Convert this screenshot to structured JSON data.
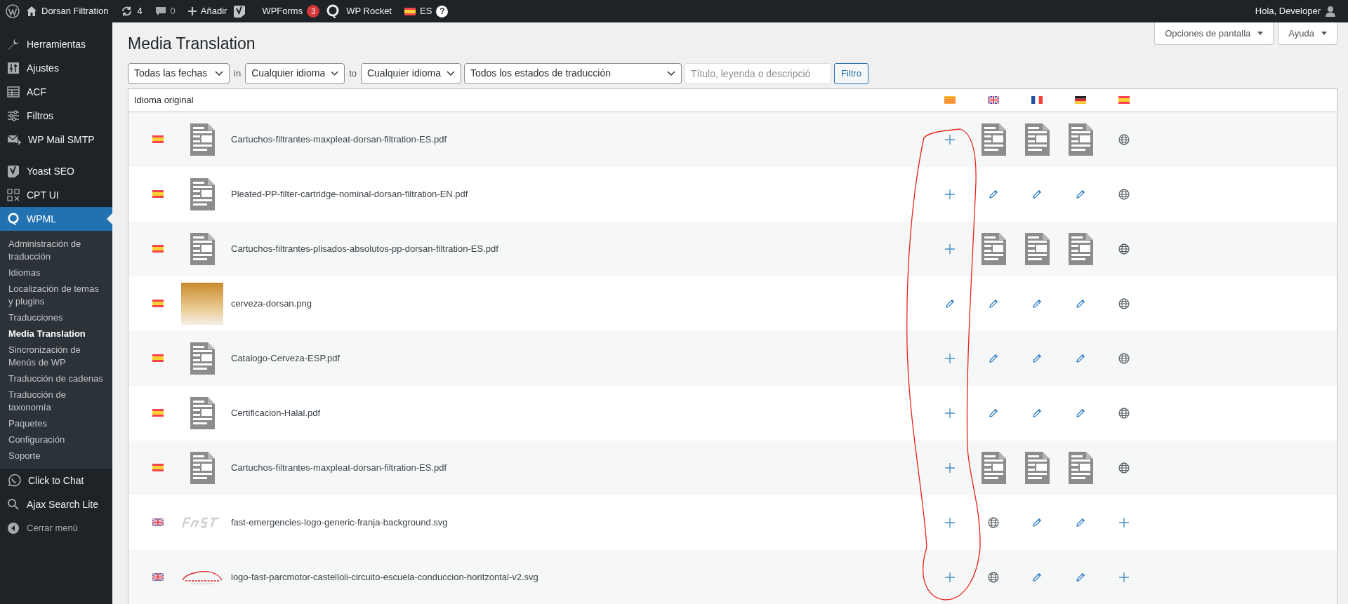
{
  "admin_bar": {
    "site": "Dorsan Filtration",
    "updates": "4",
    "comments": "0",
    "new": "Añadir",
    "wpforms": "WPForms",
    "wpforms_count": "3",
    "rocket": "WP Rocket",
    "language_flag": {
      "kind": "es"
    },
    "language": "ES",
    "help": "?",
    "greeting": "Hola, Developer"
  },
  "sidebar": {
    "groups": [
      {
        "items": [
          {
            "label": "Herramientas",
            "selected": false
          },
          {
            "label": "Ajustes",
            "selected": false
          },
          {
            "label": "ACF",
            "selected": false
          },
          {
            "label": "Filtros",
            "selected": false
          },
          {
            "label": "WP Mail SMTP",
            "selected": false
          }
        ]
      },
      {
        "items": [
          {
            "label": "Yoast SEO",
            "selected": false
          },
          {
            "label": "CPT UI",
            "selected": false
          },
          {
            "label": "WPML",
            "selected": true,
            "children": [
              {
                "label": "Administración de traducción",
                "selected": false
              },
              {
                "label": "Idiomas",
                "selected": false
              },
              {
                "label": "Localización de temas y plugins",
                "selected": false
              },
              {
                "label": "Traducciones",
                "selected": false
              },
              {
                "label": "Media Translation",
                "selected": true
              },
              {
                "label": "Sincronización de Menús de WP",
                "selected": false
              },
              {
                "label": "Traducción de cadenas",
                "selected": false
              },
              {
                "label": "Traducción de taxonomía",
                "selected": false
              },
              {
                "label": "Paquetes",
                "selected": false
              },
              {
                "label": "Configuración",
                "selected": false
              },
              {
                "label": "Soporte",
                "selected": false
              }
            ]
          },
          {
            "label": "Click to Chat",
            "selected": false
          },
          {
            "label": "Ajax Search Lite",
            "selected": false
          }
        ]
      }
    ],
    "collapse": "Cerrar menú"
  },
  "header": {
    "title": "Media Translation",
    "screen_options": "Opciones de pantalla",
    "help": "Ayuda"
  },
  "filters": {
    "date": "Todas las fechas",
    "in": "in",
    "from_language": "Cualquier idioma",
    "to": "to",
    "to_language": "Cualquier idioma",
    "status": "Todos los estados de traducción",
    "search_placeholder": "Título, leyenda o descripció",
    "button": "Filtro"
  },
  "table": {
    "column_header": "Idioma original",
    "language_columns": [
      {
        "kind": "ca"
      },
      {
        "kind": "en"
      },
      {
        "kind": "fr"
      },
      {
        "kind": "de"
      },
      {
        "kind": "es"
      }
    ],
    "rows": [
      {
        "flag": {
          "kind": "es"
        },
        "thumb": {
          "kind": "document"
        },
        "file": "Cartuchos-filtrantes-maxpleat-dorsan-filtration-ES.pdf",
        "cells": [
          {
            "kind": "add"
          },
          {
            "kind": "doc"
          },
          {
            "kind": "doc"
          },
          {
            "kind": "doc"
          },
          {
            "kind": "original"
          }
        ]
      },
      {
        "flag": {
          "kind": "es"
        },
        "thumb": {
          "kind": "document"
        },
        "file": "Pleated-PP-filter-cartridge-nominal-dorsan-filtration-EN.pdf",
        "cells": [
          {
            "kind": "add"
          },
          {
            "kind": "edit"
          },
          {
            "kind": "edit"
          },
          {
            "kind": "edit"
          },
          {
            "kind": "original"
          }
        ]
      },
      {
        "flag": {
          "kind": "es"
        },
        "thumb": {
          "kind": "document"
        },
        "file": "Cartuchos-filtrantes-plisados-absolutos-pp-dorsan-filtration-ES.pdf",
        "cells": [
          {
            "kind": "add"
          },
          {
            "kind": "doc"
          },
          {
            "kind": "doc"
          },
          {
            "kind": "doc"
          },
          {
            "kind": "original"
          }
        ]
      },
      {
        "flag": {
          "kind": "es"
        },
        "thumb": {
          "kind": "photo"
        },
        "file": "cerveza-dorsan.png",
        "cells": [
          {
            "kind": "edit"
          },
          {
            "kind": "edit"
          },
          {
            "kind": "edit"
          },
          {
            "kind": "edit"
          },
          {
            "kind": "original"
          }
        ]
      },
      {
        "flag": {
          "kind": "es"
        },
        "thumb": {
          "kind": "document"
        },
        "file": "Catalogo-Cerveza-ESP.pdf",
        "cells": [
          {
            "kind": "add"
          },
          {
            "kind": "edit"
          },
          {
            "kind": "edit"
          },
          {
            "kind": "edit"
          },
          {
            "kind": "original"
          }
        ]
      },
      {
        "flag": {
          "kind": "es"
        },
        "thumb": {
          "kind": "document"
        },
        "file": "Certificacion-Halal.pdf",
        "cells": [
          {
            "kind": "add"
          },
          {
            "kind": "edit"
          },
          {
            "kind": "edit"
          },
          {
            "kind": "edit"
          },
          {
            "kind": "original"
          }
        ]
      },
      {
        "flag": {
          "kind": "es"
        },
        "thumb": {
          "kind": "document"
        },
        "file": "Cartuchos-filtrantes-maxpleat-dorsan-filtration-ES.pdf",
        "cells": [
          {
            "kind": "add"
          },
          {
            "kind": "doc"
          },
          {
            "kind": "doc"
          },
          {
            "kind": "doc"
          },
          {
            "kind": "original"
          }
        ]
      },
      {
        "flag": {
          "kind": "en"
        },
        "thumb": {
          "kind": "wordmark"
        },
        "file": "fast-emergencies-logo-generic-franja-background.svg",
        "cells": [
          {
            "kind": "add"
          },
          {
            "kind": "original"
          },
          {
            "kind": "edit"
          },
          {
            "kind": "edit"
          },
          {
            "kind": "add"
          }
        ]
      },
      {
        "flag": {
          "kind": "en"
        },
        "thumb": {
          "kind": "car"
        },
        "file": "logo-fast-parcmotor-castelloli-circuito-escuela-conduccion-horitzontal-v2.svg",
        "cells": [
          {
            "kind": "add"
          },
          {
            "kind": "original"
          },
          {
            "kind": "edit"
          },
          {
            "kind": "edit"
          },
          {
            "kind": "add"
          }
        ]
      }
    ]
  }
}
